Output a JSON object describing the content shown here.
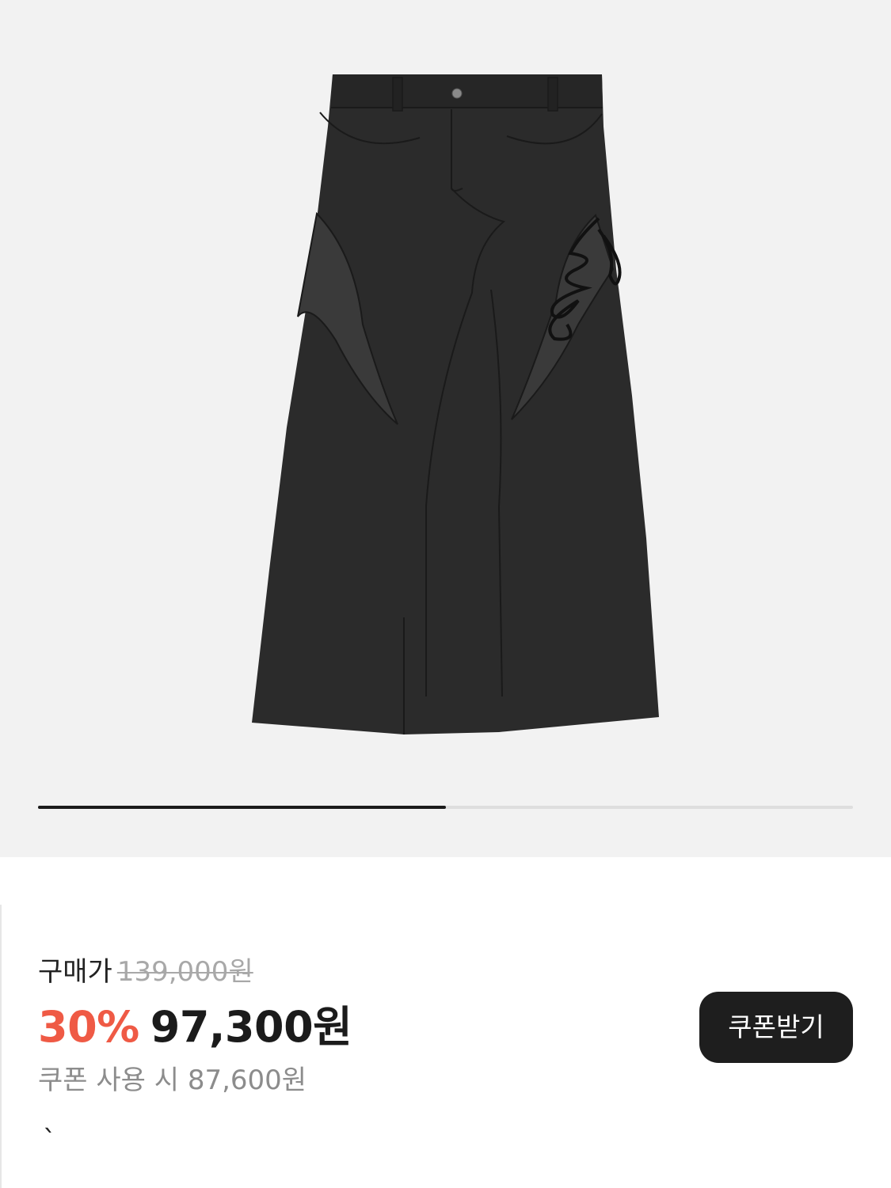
{
  "product": {
    "image_alt": "black maxi skirt",
    "gallery_progress_fraction": 0.5
  },
  "pricing": {
    "label": "구매가",
    "original_price": "139,000원",
    "discount_rate": "30%",
    "sale_price": "97,300원",
    "coupon_price_text": "쿠폰 사용 시 87,600원"
  },
  "coupon_button": {
    "label": "쿠폰받기"
  },
  "misc": {
    "stray_char": "`"
  },
  "colors": {
    "gallery_background": "#f2f2f2",
    "discount": "#ef5a45",
    "primary_text": "#1b1b1b",
    "muted_text": "#8c8c8c",
    "strike_text": "#a8a8a8",
    "button_background": "#1e1e1e",
    "button_text": "#ffffff"
  }
}
